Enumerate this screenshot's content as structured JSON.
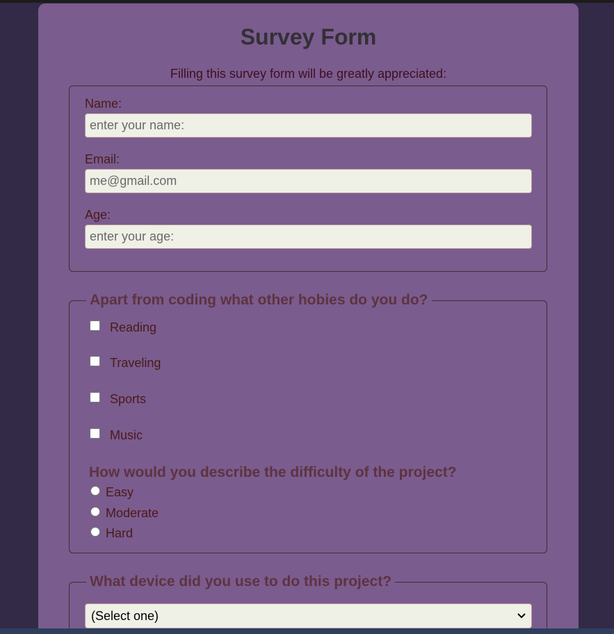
{
  "title": "Survey Form",
  "subtitle": "Filling this survey form will be greatly appreciated:",
  "personal": {
    "name_label": "Name:",
    "name_placeholder": "enter your name:",
    "email_label": "Email:",
    "email_placeholder": "me@gmail.com",
    "age_label": "Age:",
    "age_placeholder": "enter your age:"
  },
  "hobbies": {
    "legend": "Apart from coding what other hobies do you do?",
    "options": [
      "Reading",
      "Traveling",
      "Sports",
      "Music"
    ]
  },
  "difficulty": {
    "question": "How would you describe the difficulty of the project?",
    "options": [
      "Easy",
      "Moderate",
      "Hard"
    ]
  },
  "device": {
    "legend": "What device did you use to do this project?",
    "selected": "(Select one)",
    "icon": "chevron-down-icon"
  },
  "colors": {
    "background": "#332a47",
    "card": "#7a5c8e",
    "legend": "#5e3340",
    "input": "#eff0e6"
  }
}
